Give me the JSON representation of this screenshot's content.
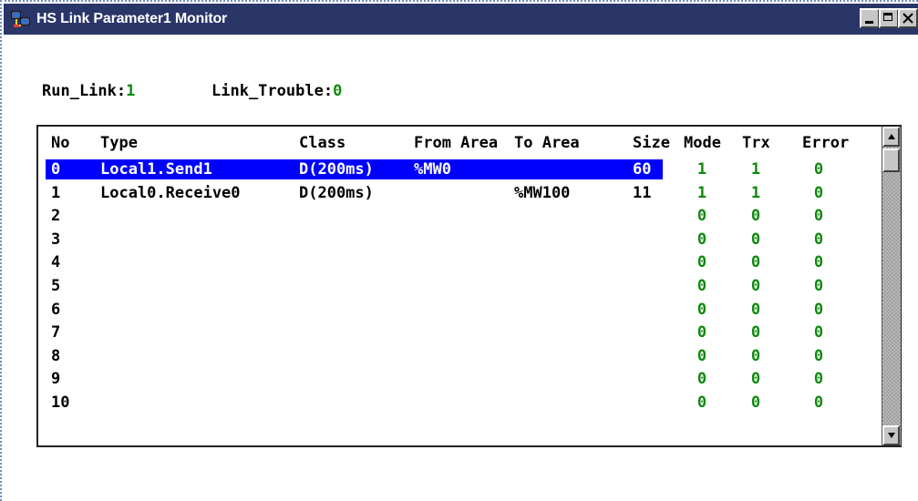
{
  "window": {
    "title": "HS Link Parameter1 Monitor",
    "titlebar_color": "#2a3568",
    "icons": {
      "app": "app-icon",
      "minimize": "minimize-icon",
      "maximize": "maximize-icon",
      "close": "close-icon"
    }
  },
  "status": {
    "run_link_label": "Run_Link:",
    "run_link_value": "1",
    "link_trouble_label": "Link_Trouble:",
    "link_trouble_value": "0"
  },
  "table": {
    "columns": [
      "No",
      "Type",
      "Class",
      "From Area",
      "To Area",
      "Size",
      "Mode",
      "Trx",
      "Error"
    ],
    "rows": [
      {
        "no": "0",
        "type": "Local1.Send1",
        "class": "D(200ms)",
        "from": "%MW0",
        "to": "",
        "size": "60",
        "mode": "1",
        "trx": "1",
        "error": "0"
      },
      {
        "no": "1",
        "type": "Local0.Receive0",
        "class": "D(200ms)",
        "from": "",
        "to": "%MW100",
        "size": "11",
        "mode": "1",
        "trx": "1",
        "error": "0"
      },
      {
        "no": "2",
        "type": "",
        "class": "",
        "from": "",
        "to": "",
        "size": "",
        "mode": "0",
        "trx": "0",
        "error": "0"
      },
      {
        "no": "3",
        "type": "",
        "class": "",
        "from": "",
        "to": "",
        "size": "",
        "mode": "0",
        "trx": "0",
        "error": "0"
      },
      {
        "no": "4",
        "type": "",
        "class": "",
        "from": "",
        "to": "",
        "size": "",
        "mode": "0",
        "trx": "0",
        "error": "0"
      },
      {
        "no": "5",
        "type": "",
        "class": "",
        "from": "",
        "to": "",
        "size": "",
        "mode": "0",
        "trx": "0",
        "error": "0"
      },
      {
        "no": "6",
        "type": "",
        "class": "",
        "from": "",
        "to": "",
        "size": "",
        "mode": "0",
        "trx": "0",
        "error": "0"
      },
      {
        "no": "7",
        "type": "",
        "class": "",
        "from": "",
        "to": "",
        "size": "",
        "mode": "0",
        "trx": "0",
        "error": "0"
      },
      {
        "no": "8",
        "type": "",
        "class": "",
        "from": "",
        "to": "",
        "size": "",
        "mode": "0",
        "trx": "0",
        "error": "0"
      },
      {
        "no": "9",
        "type": "",
        "class": "",
        "from": "",
        "to": "",
        "size": "",
        "mode": "0",
        "trx": "0",
        "error": "0"
      },
      {
        "no": "10",
        "type": "",
        "class": "",
        "from": "",
        "to": "",
        "size": "",
        "mode": "0",
        "trx": "0",
        "error": "0"
      }
    ],
    "selected_row": 0,
    "selection_color": "#0000ff",
    "status_value_color": "#0b8a0b"
  }
}
